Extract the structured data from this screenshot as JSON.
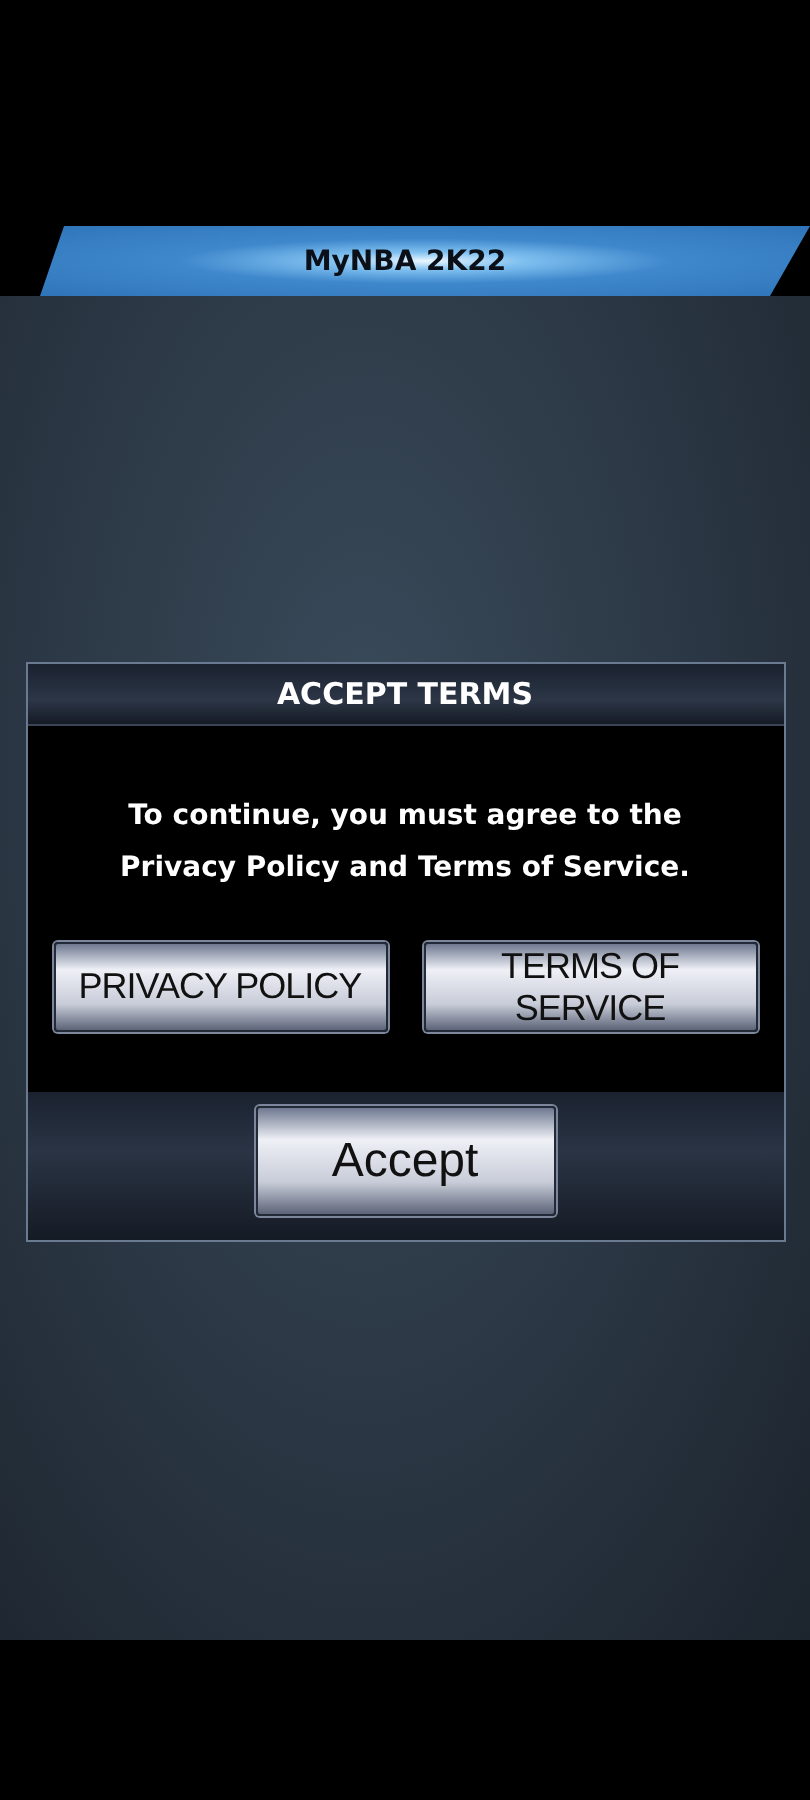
{
  "banner": {
    "title": "MyNBA 2K22"
  },
  "dialog": {
    "title": "ACCEPT TERMS",
    "message": "To continue, you must agree to the Privacy Policy and Terms of Service.",
    "links": [
      {
        "label": "PRIVACY POLICY"
      },
      {
        "label": "TERMS OF SERVICE"
      }
    ],
    "button": "Accept"
  }
}
